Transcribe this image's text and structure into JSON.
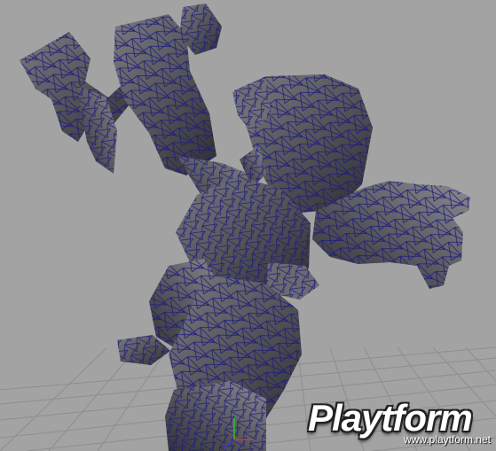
{
  "viewport": {
    "name": "3d-modeling-viewport",
    "background_color": "#a3a3a3",
    "grid_color": "#8e8e8e",
    "wire_color": "#1a1a7a",
    "shade_color": "#4e4e52"
  },
  "watermark": {
    "logo": "Playtform",
    "url": "www.playtform.net"
  }
}
